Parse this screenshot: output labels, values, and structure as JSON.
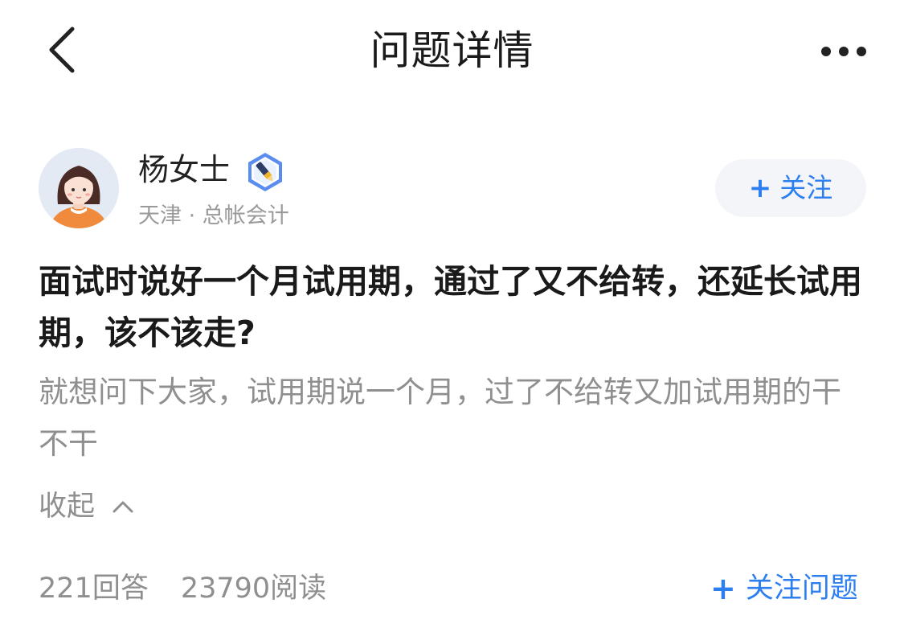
{
  "nav": {
    "title": "问题详情",
    "back_icon": "chevron-left-icon",
    "more_icon": "more-horizontal-icon"
  },
  "author": {
    "name": "杨女士",
    "location": "天津",
    "separator": " · ",
    "profession": "总帐会计",
    "badge_icon": "verified-badge-icon",
    "follow_plus": "+",
    "follow_label": "关注"
  },
  "question": {
    "title": "面试时说好一个月试用期，通过了又不给转，还延长试用期，该不该走?",
    "body": "就想问下大家，试用期说一个月，过了不给转又加试用期的干不干",
    "collapse_label": "收起",
    "collapse_icon": "chevron-up-icon"
  },
  "stats": {
    "answers_count": "221",
    "answers_label": "回答",
    "reads_count": "23790",
    "reads_label": "阅读"
  },
  "follow_question": {
    "plus": "+",
    "label": "关注问题"
  },
  "colors": {
    "accent": "#2d7ff0",
    "muted_text": "#8f8f8f",
    "primary_text": "#1a1a1a",
    "button_bg": "#f3f5f8"
  }
}
